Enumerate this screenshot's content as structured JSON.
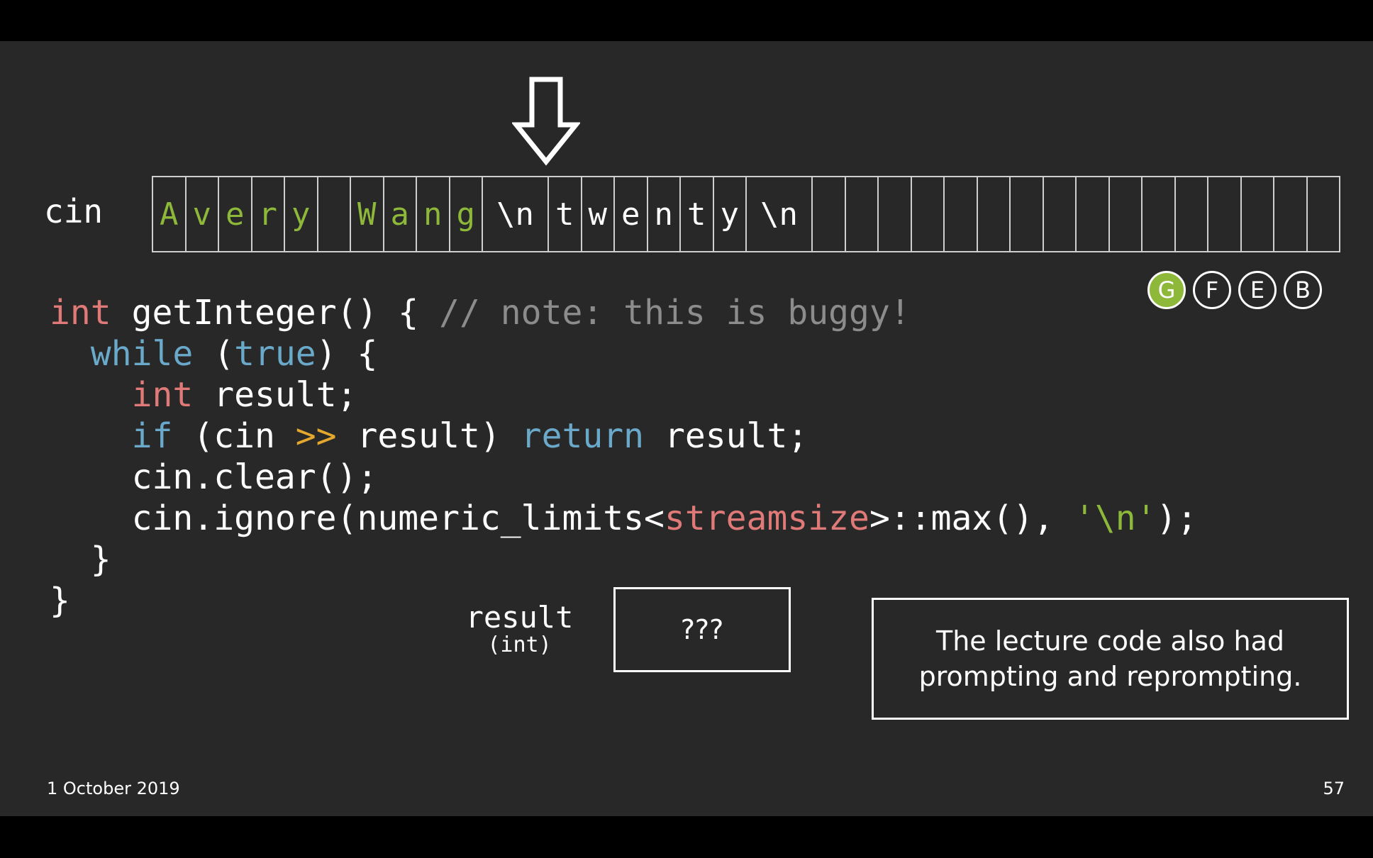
{
  "buffer": {
    "label": "cin",
    "cells": [
      {
        "text": "A",
        "color": "green"
      },
      {
        "text": "v",
        "color": "green"
      },
      {
        "text": "e",
        "color": "green"
      },
      {
        "text": "r",
        "color": "green"
      },
      {
        "text": "y",
        "color": "green"
      },
      {
        "text": "",
        "color": "white"
      },
      {
        "text": "W",
        "color": "green"
      },
      {
        "text": "a",
        "color": "green"
      },
      {
        "text": "n",
        "color": "green"
      },
      {
        "text": "g",
        "color": "green"
      },
      {
        "text": "\\n",
        "color": "white",
        "wide": true
      },
      {
        "text": "t",
        "color": "white"
      },
      {
        "text": "w",
        "color": "white"
      },
      {
        "text": "e",
        "color": "white"
      },
      {
        "text": "n",
        "color": "white"
      },
      {
        "text": "t",
        "color": "white"
      },
      {
        "text": "y",
        "color": "white"
      },
      {
        "text": "\\n",
        "color": "white",
        "wide": true
      },
      {
        "text": ""
      },
      {
        "text": ""
      },
      {
        "text": ""
      },
      {
        "text": ""
      },
      {
        "text": ""
      },
      {
        "text": ""
      },
      {
        "text": ""
      },
      {
        "text": ""
      },
      {
        "text": ""
      },
      {
        "text": ""
      },
      {
        "text": ""
      },
      {
        "text": ""
      },
      {
        "text": ""
      },
      {
        "text": ""
      },
      {
        "text": ""
      },
      {
        "text": ""
      }
    ]
  },
  "markers": [
    {
      "label": "G",
      "active": true
    },
    {
      "label": "F",
      "active": false
    },
    {
      "label": "E",
      "active": false
    },
    {
      "label": "B",
      "active": false
    }
  ],
  "code": {
    "l1": {
      "type": "int",
      "sig": " getInteger() { ",
      "comment": "// note: this is buggy!"
    },
    "l2": {
      "indent": "  ",
      "kw_while": "while",
      "sp": " (",
      "kw_true": "true",
      "rest": ") {"
    },
    "l3": {
      "indent": "    ",
      "type": "int",
      "rest": " result;"
    },
    "l4": {
      "indent": "    ",
      "kw_if": "if",
      "mid1": " (cin ",
      "op": ">>",
      "mid2": " result) ",
      "kw_return": "return",
      "rest": " result;"
    },
    "l5": {
      "text": "    cin.clear();"
    },
    "l6": {
      "pre": "    cin.ignore(numeric_limits<",
      "type": "streamsize",
      "mid": ">::max(), ",
      "str": "'\\n'",
      "rest": ");"
    },
    "l7": {
      "text": "  }"
    },
    "l8": {
      "text": "}"
    }
  },
  "result": {
    "name": "result",
    "type": "(int)",
    "value": "???"
  },
  "note": {
    "text": "The lecture code also had prompting and reprompting."
  },
  "footer": {
    "date": "1 October 2019",
    "page": "57"
  },
  "colors": {
    "green": "#8db83a",
    "type": "#e07a78",
    "keyword": "#6aa9c9",
    "operator": "#e4a82e",
    "comment": "#8c8c8c",
    "background": "#282828"
  },
  "icons": {
    "pointer": "down-arrow-icon"
  }
}
